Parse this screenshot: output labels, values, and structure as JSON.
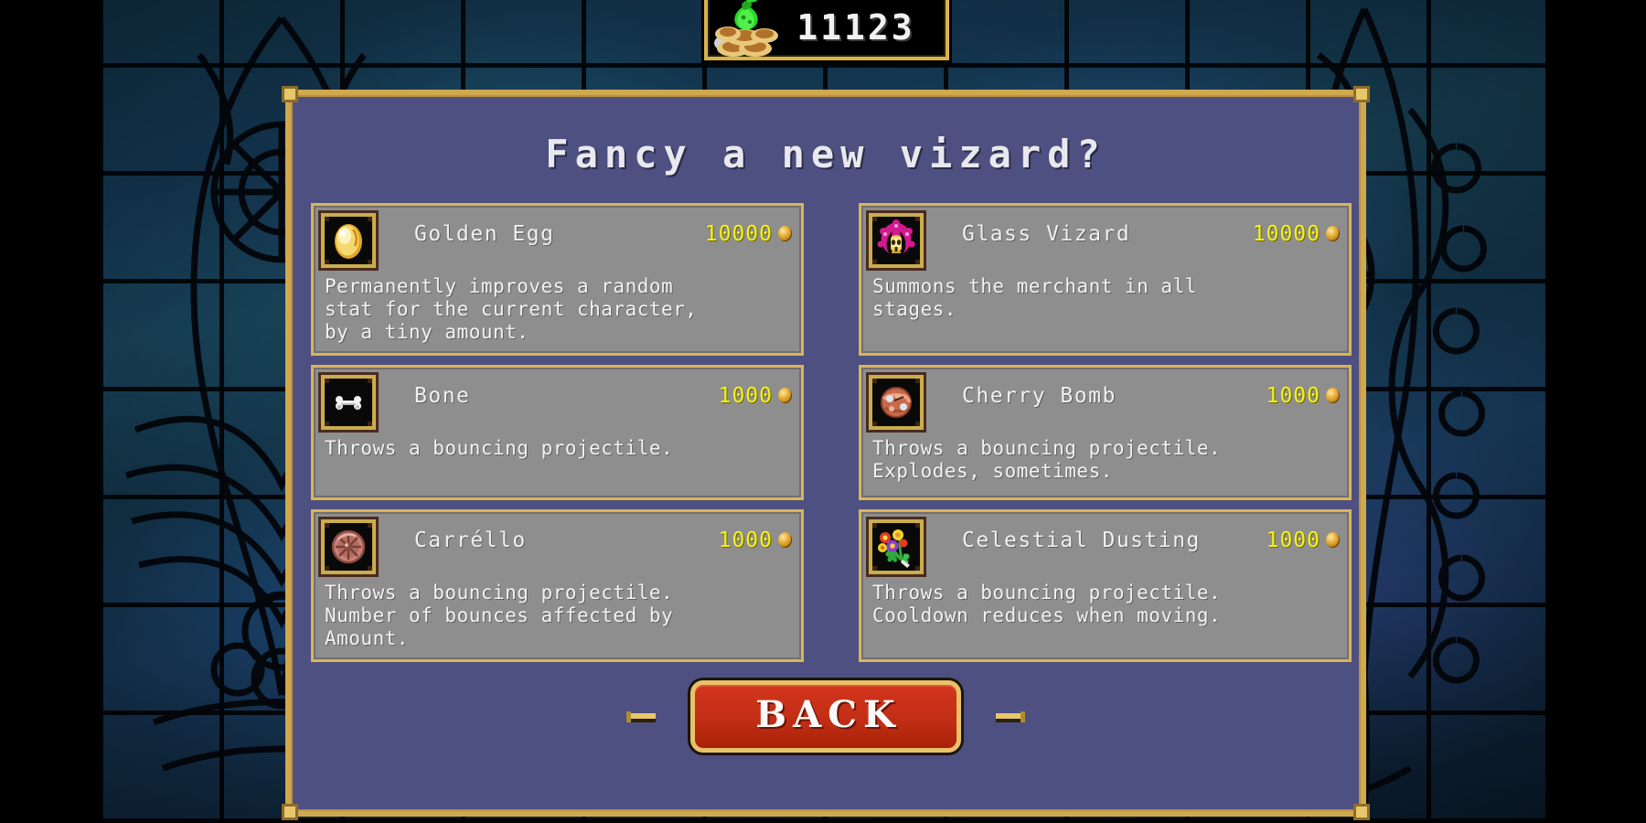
{
  "hud": {
    "money_icon": "money-bag-on-coins-icon",
    "money_amount": "11123"
  },
  "panel": {
    "title": "Fancy a new vizard?",
    "border_color": "#d0a84e",
    "background_color": "#4d5080"
  },
  "items": [
    {
      "name": "Golden Egg",
      "price": "10000",
      "currency_icon": "gold-coin-icon",
      "icon": "golden-egg-icon",
      "description": "Permanently improves a random\nstat for the current character,\nby a tiny amount."
    },
    {
      "name": "Glass Vizard",
      "price": "10000",
      "currency_icon": "gold-coin-icon",
      "icon": "glass-vizard-skull-icon",
      "description": "Summons the merchant in all\nstages."
    },
    {
      "name": "Bone",
      "price": "1000",
      "currency_icon": "gold-coin-icon",
      "icon": "bone-icon",
      "description": "Throws a bouncing projectile."
    },
    {
      "name": "Cherry Bomb",
      "price": "1000",
      "currency_icon": "gold-coin-icon",
      "icon": "cherry-bomb-icon",
      "description": "Throws a bouncing projectile.\nExplodes, sometimes."
    },
    {
      "name": "Carréllo",
      "price": "1000",
      "currency_icon": "gold-coin-icon",
      "icon": "wagon-wheel-icon",
      "description": "Throws a bouncing projectile.\nNumber of bounces affected by\nAmount."
    },
    {
      "name": "Celestial Dusting",
      "price": "1000",
      "currency_icon": "gold-coin-icon",
      "icon": "flower-bouquet-icon",
      "description": "Throws a bouncing projectile.\nCooldown reduces when moving."
    }
  ],
  "footer": {
    "back_label": "BACK",
    "selector_icon": "gold-dash-selector-icon",
    "back_color": "#c22e15"
  },
  "colors": {
    "price_yellow": "#f5f11d",
    "card_gray": "#8e8e8e",
    "gold": "#d8b45c"
  }
}
